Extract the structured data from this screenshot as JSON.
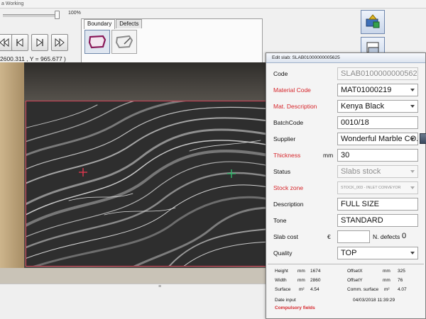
{
  "window": {
    "title": "a Working"
  },
  "zoom": {
    "label": "100%",
    "level": 1.0
  },
  "coords": "2600.311 , Y = 965.677 )",
  "defects_panel": {
    "tabs": [
      "Boundary",
      "Defects"
    ],
    "active_tab": "Boundary"
  },
  "nav_icons": [
    "first-icon",
    "previous-icon",
    "next-icon",
    "last-icon"
  ],
  "dialog": {
    "title": "Edit slab: SLAB01000000005625",
    "fields": {
      "code": {
        "label": "Code",
        "value": "SLAB01000000005625"
      },
      "material_code": {
        "label": "Material Code",
        "value": "MAT01000219"
      },
      "mat_description": {
        "label": "Mat. Description",
        "value": "Kenya Black"
      },
      "batch_code": {
        "label": "BatchCode",
        "value": "0010/18"
      },
      "supplier": {
        "label": "Supplier",
        "value": "Wonderful Marble CO."
      },
      "thickness": {
        "label": "Thickness",
        "unit": "mm",
        "value": "30"
      },
      "status": {
        "label": "Status",
        "value": "Slabs stock"
      },
      "stock_zone": {
        "label": "Stock zone",
        "value": "STOCK_003 - INLET CONVEYOR"
      },
      "description": {
        "label": "Description",
        "value": "FULL SIZE"
      },
      "tone": {
        "label": "Tone",
        "value": "STANDARD"
      },
      "slab_cost": {
        "label": "Slab cost",
        "unit": "€",
        "value": ""
      },
      "n_defects": {
        "label": "N. defects",
        "value": "0"
      },
      "quality": {
        "label": "Quality",
        "value": "TOP"
      }
    },
    "summary": {
      "height": {
        "label": "Height",
        "unit": "mm",
        "value": "1674"
      },
      "width": {
        "label": "Width",
        "unit": "mm",
        "value": "2860"
      },
      "surface": {
        "label": "Surface",
        "unit": "m²",
        "value": "4.54"
      },
      "offset_x": {
        "label": "OffsetX",
        "unit": "mm",
        "value": "325"
      },
      "offset_y": {
        "label": "OffsetY",
        "unit": "mm",
        "value": "76"
      },
      "comm_surface": {
        "label": "Comm. surface",
        "unit": "m²",
        "value": "4.07"
      },
      "date_input": {
        "label": "Date input",
        "value": "04/03/2018 11:39:29"
      },
      "compulsory_note": "Compulsory fields"
    }
  },
  "colors": {
    "required_label": "#d6262b",
    "slab_outline": "#d8465a",
    "boundary_icon": "#8a1a5a"
  }
}
